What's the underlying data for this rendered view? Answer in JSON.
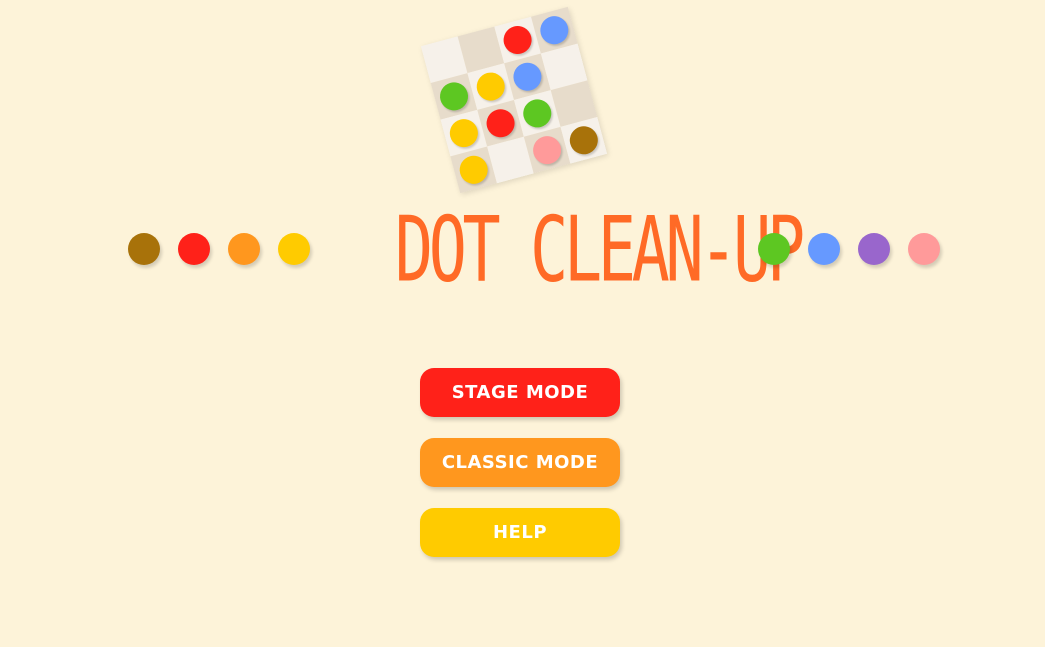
{
  "title": "DOT CLEAN-UP",
  "colors": {
    "background": "#fdf3d9",
    "title": "#ff6a26",
    "brown": "#a8720a",
    "red": "#ff2119",
    "orange": "#ff971e",
    "yellow": "#ffcb00",
    "green": "#5dc722",
    "blue": "#6699ff",
    "purple": "#9966cc",
    "pink": "#ff9a9a"
  },
  "logo_board": {
    "rows": [
      [
        "light",
        "dark",
        "red",
        "blue"
      ],
      [
        "green",
        "yellow",
        "blue",
        "light"
      ],
      [
        "yellow",
        "red",
        "green",
        "dark"
      ],
      [
        "yellow",
        "light",
        "pink",
        "brown"
      ]
    ]
  },
  "title_dots_left": [
    "brown",
    "red",
    "orange",
    "yellow"
  ],
  "title_dots_right": [
    "green",
    "blue",
    "purple",
    "pink"
  ],
  "menu": {
    "stage_mode": "STAGE MODE",
    "classic_mode": "CLASSIC MODE",
    "help": "HELP"
  }
}
